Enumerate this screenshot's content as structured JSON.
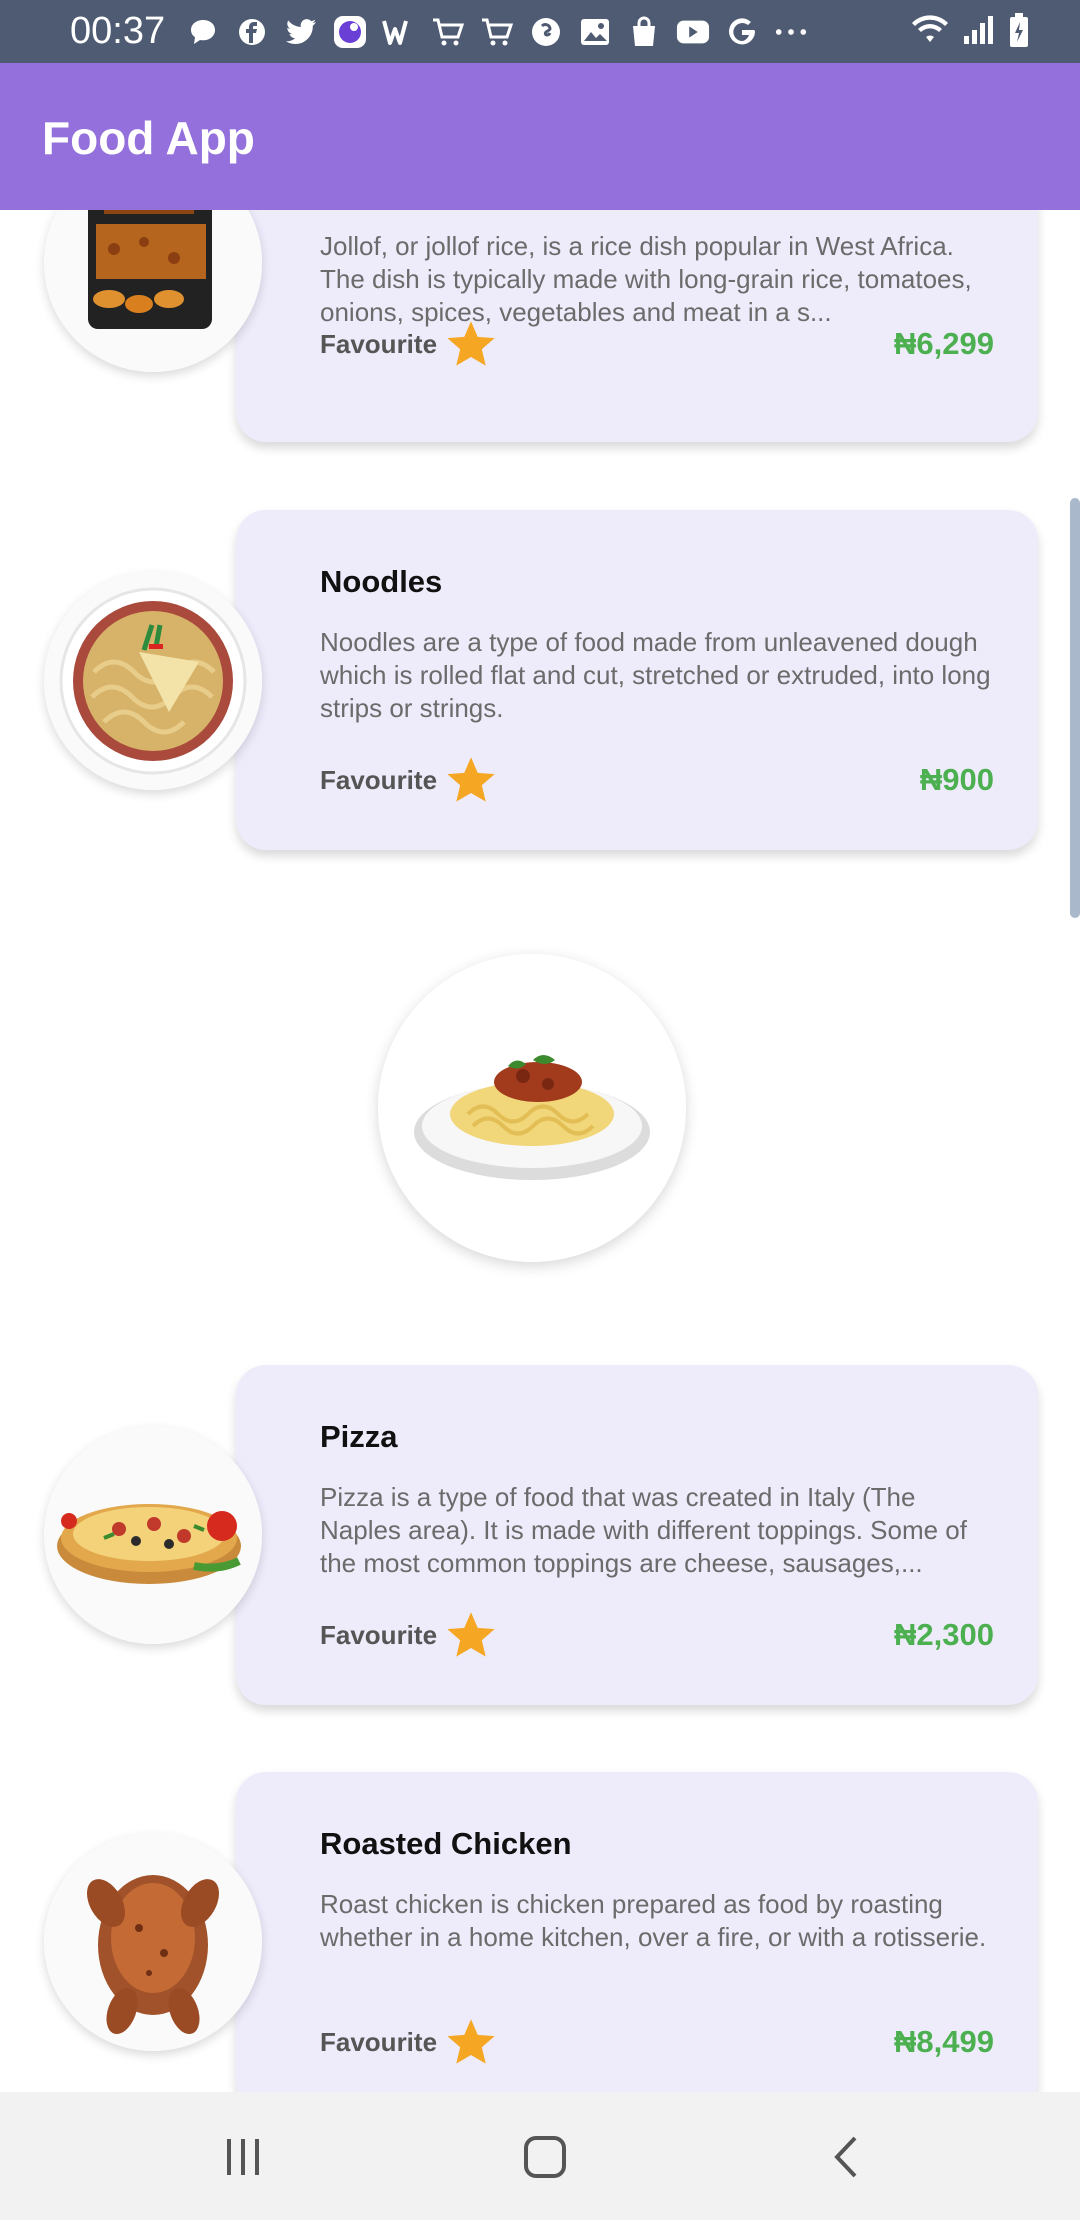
{
  "status_bar": {
    "time": "00:37",
    "icons": [
      "message-icon",
      "facebook-icon",
      "twitter-icon",
      "app-icon",
      "w-icon",
      "cart-icon",
      "cart-icon",
      "shazam-icon",
      "gallery-icon",
      "bag-icon",
      "youtube-icon",
      "google-icon",
      "more-icon"
    ],
    "right_icons": [
      "wifi-icon",
      "signal-icon",
      "battery-icon"
    ]
  },
  "app_bar": {
    "title": "Food App"
  },
  "foods": [
    {
      "name": "",
      "description": "Jollof, or jollof rice, is a rice dish popular in West Africa. The dish is typically made with long-grain rice, tomatoes, onions, spices, vegetables and meat in a s...",
      "favourite_label": "Favourite",
      "price": "₦6,299"
    },
    {
      "name": "Noodles",
      "description": "Noodles are a type of food made from unleavened dough which is rolled flat and cut, stretched or extruded, into long strips or strings.",
      "favourite_label": "Favourite",
      "price": "₦900"
    },
    {
      "name": "Pizza",
      "description": "Pizza is a type of food that was created in Italy (The Naples area). It is made with different toppings. Some of the most common toppings are cheese, sausages,...",
      "favourite_label": "Favourite",
      "price": "₦2,300"
    },
    {
      "name": "Roasted Chicken",
      "description": "Roast chicken is chicken prepared as food by roasting whether in a home kitchen, over a fire, or with a rotisserie.",
      "favourite_label": "Favourite",
      "price": "₦8,499"
    }
  ],
  "colors": {
    "app_bar": "#9370db",
    "status_bar": "#4f5b73",
    "card_bg": "#eeecfb",
    "price": "#4caf50",
    "star": "#f5a623"
  },
  "nav_bar": {
    "buttons": [
      "recent-apps-icon",
      "home-icon",
      "back-icon"
    ]
  }
}
